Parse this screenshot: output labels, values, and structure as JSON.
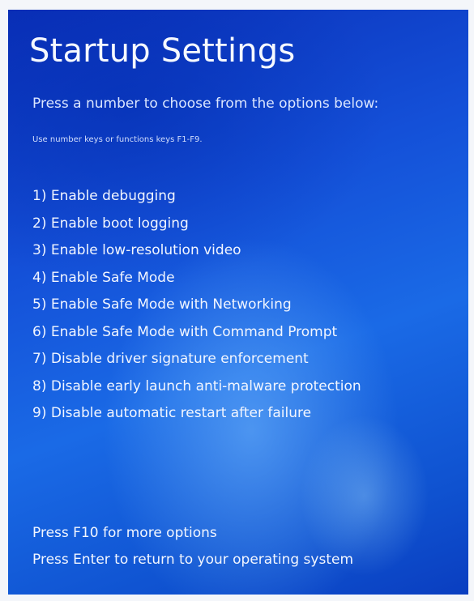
{
  "screen": {
    "title": "Startup Settings",
    "subtitle": "Press a number to choose from the options below:",
    "hint": "Use number keys or functions keys F1-F9."
  },
  "options": [
    {
      "label": "1) Enable debugging"
    },
    {
      "label": "2) Enable boot logging"
    },
    {
      "label": "3) Enable low-resolution video"
    },
    {
      "label": "4) Enable Safe Mode"
    },
    {
      "label": "5) Enable Safe Mode with Networking"
    },
    {
      "label": "6) Enable Safe Mode with Command Prompt"
    },
    {
      "label": "7) Disable driver signature enforcement"
    },
    {
      "label": "8) Disable early launch anti-malware protection"
    },
    {
      "label": "9) Disable automatic restart after failure"
    }
  ],
  "footer": {
    "more_options": "Press F10 for more options",
    "return_os": "Press Enter to return to your operating system"
  },
  "colors": {
    "background": "#1450d8",
    "text": "#f2f6ff"
  }
}
